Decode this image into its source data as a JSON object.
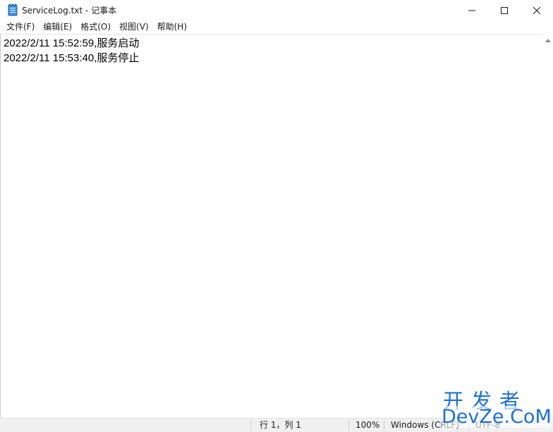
{
  "window": {
    "title": "ServiceLog.txt - 记事本",
    "icon": "notepad-icon",
    "controls": {
      "minimize_icon": "minimize-icon",
      "maximize_icon": "maximize-icon",
      "close_icon": "close-icon"
    }
  },
  "menu": {
    "items": [
      {
        "label": "文件(F)"
      },
      {
        "label": "编辑(E)"
      },
      {
        "label": "格式(O)"
      },
      {
        "label": "视图(V)"
      },
      {
        "label": "帮助(H)"
      }
    ]
  },
  "editor": {
    "lines": [
      "2022/2/11 15:52:59,服务启动",
      "2022/2/11 15:53:40,服务停止"
    ]
  },
  "status": {
    "position": "行 1，列 1",
    "zoom": "100%",
    "line_ending": "Windows (CRLF)",
    "encoding": "UTF-8"
  },
  "watermark": {
    "top": "开发者",
    "bottom": "DevZe.CoM"
  },
  "colors": {
    "watermark": "#1e6fd9",
    "statusbar_bg": "#f0f0f0",
    "text": "#000000"
  }
}
